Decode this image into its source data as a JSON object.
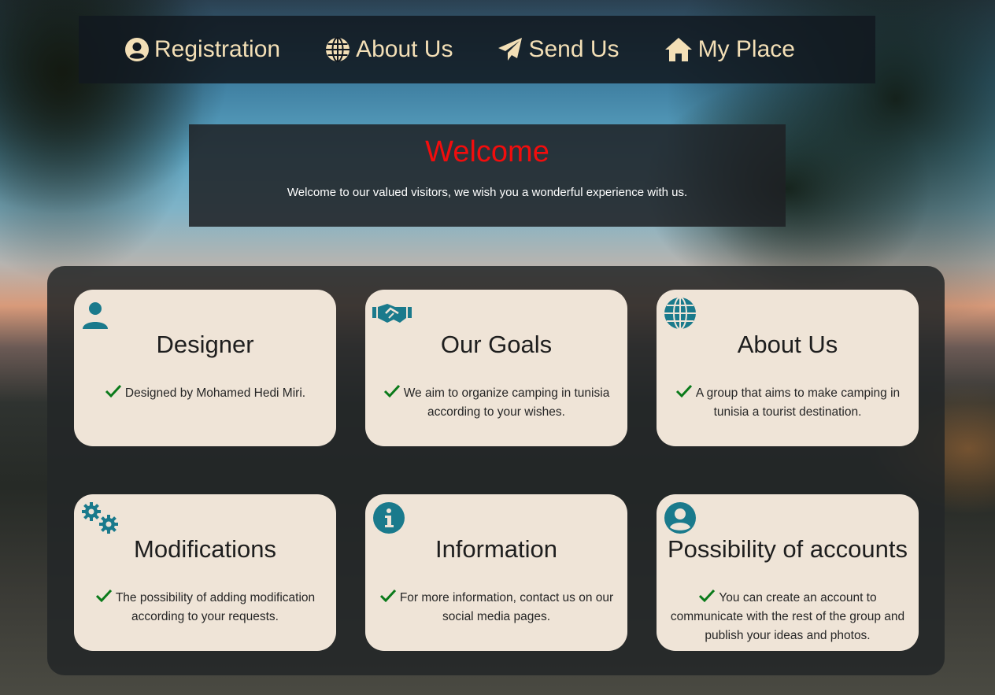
{
  "nav": {
    "items": [
      {
        "label": "Registration",
        "icon": "user-circle-icon"
      },
      {
        "label": "About Us",
        "icon": "globe-icon"
      },
      {
        "label": "Send Us",
        "icon": "paper-plane-icon"
      },
      {
        "label": "My Place",
        "icon": "home-icon"
      }
    ]
  },
  "welcome": {
    "title": "Welcome",
    "text": "Welcome to our valued visitors, we wish you a wonderful experience with us."
  },
  "cards": [
    {
      "title": "Designer",
      "text": "Designed by Mohamed Hedi Miri.",
      "icon": "user-icon"
    },
    {
      "title": "Our Goals",
      "text": "We aim to organize camping in tunisia according to your wishes.",
      "icon": "handshake-icon"
    },
    {
      "title": "About Us",
      "text": "A group that aims to make camping in tunisia a tourist destination.",
      "icon": "globe-icon"
    },
    {
      "title": "Modifications",
      "text": "The possibility of adding modification according to your requests.",
      "icon": "gears-icon"
    },
    {
      "title": "Information",
      "text": "For more information, contact us on our social media pages.",
      "icon": "info-icon"
    },
    {
      "title": "Possibility of accounts",
      "text": "You can create an account to communicate with the rest of the group and publish your ideas and photos.",
      "icon": "user-circle-icon"
    }
  ],
  "colors": {
    "nav_text": "#f3dfb6",
    "welcome_title": "#f20d0d",
    "card_bg": "#efe4d7",
    "icon_teal": "#1a7a8c",
    "check_green": "#0a7a1a"
  }
}
